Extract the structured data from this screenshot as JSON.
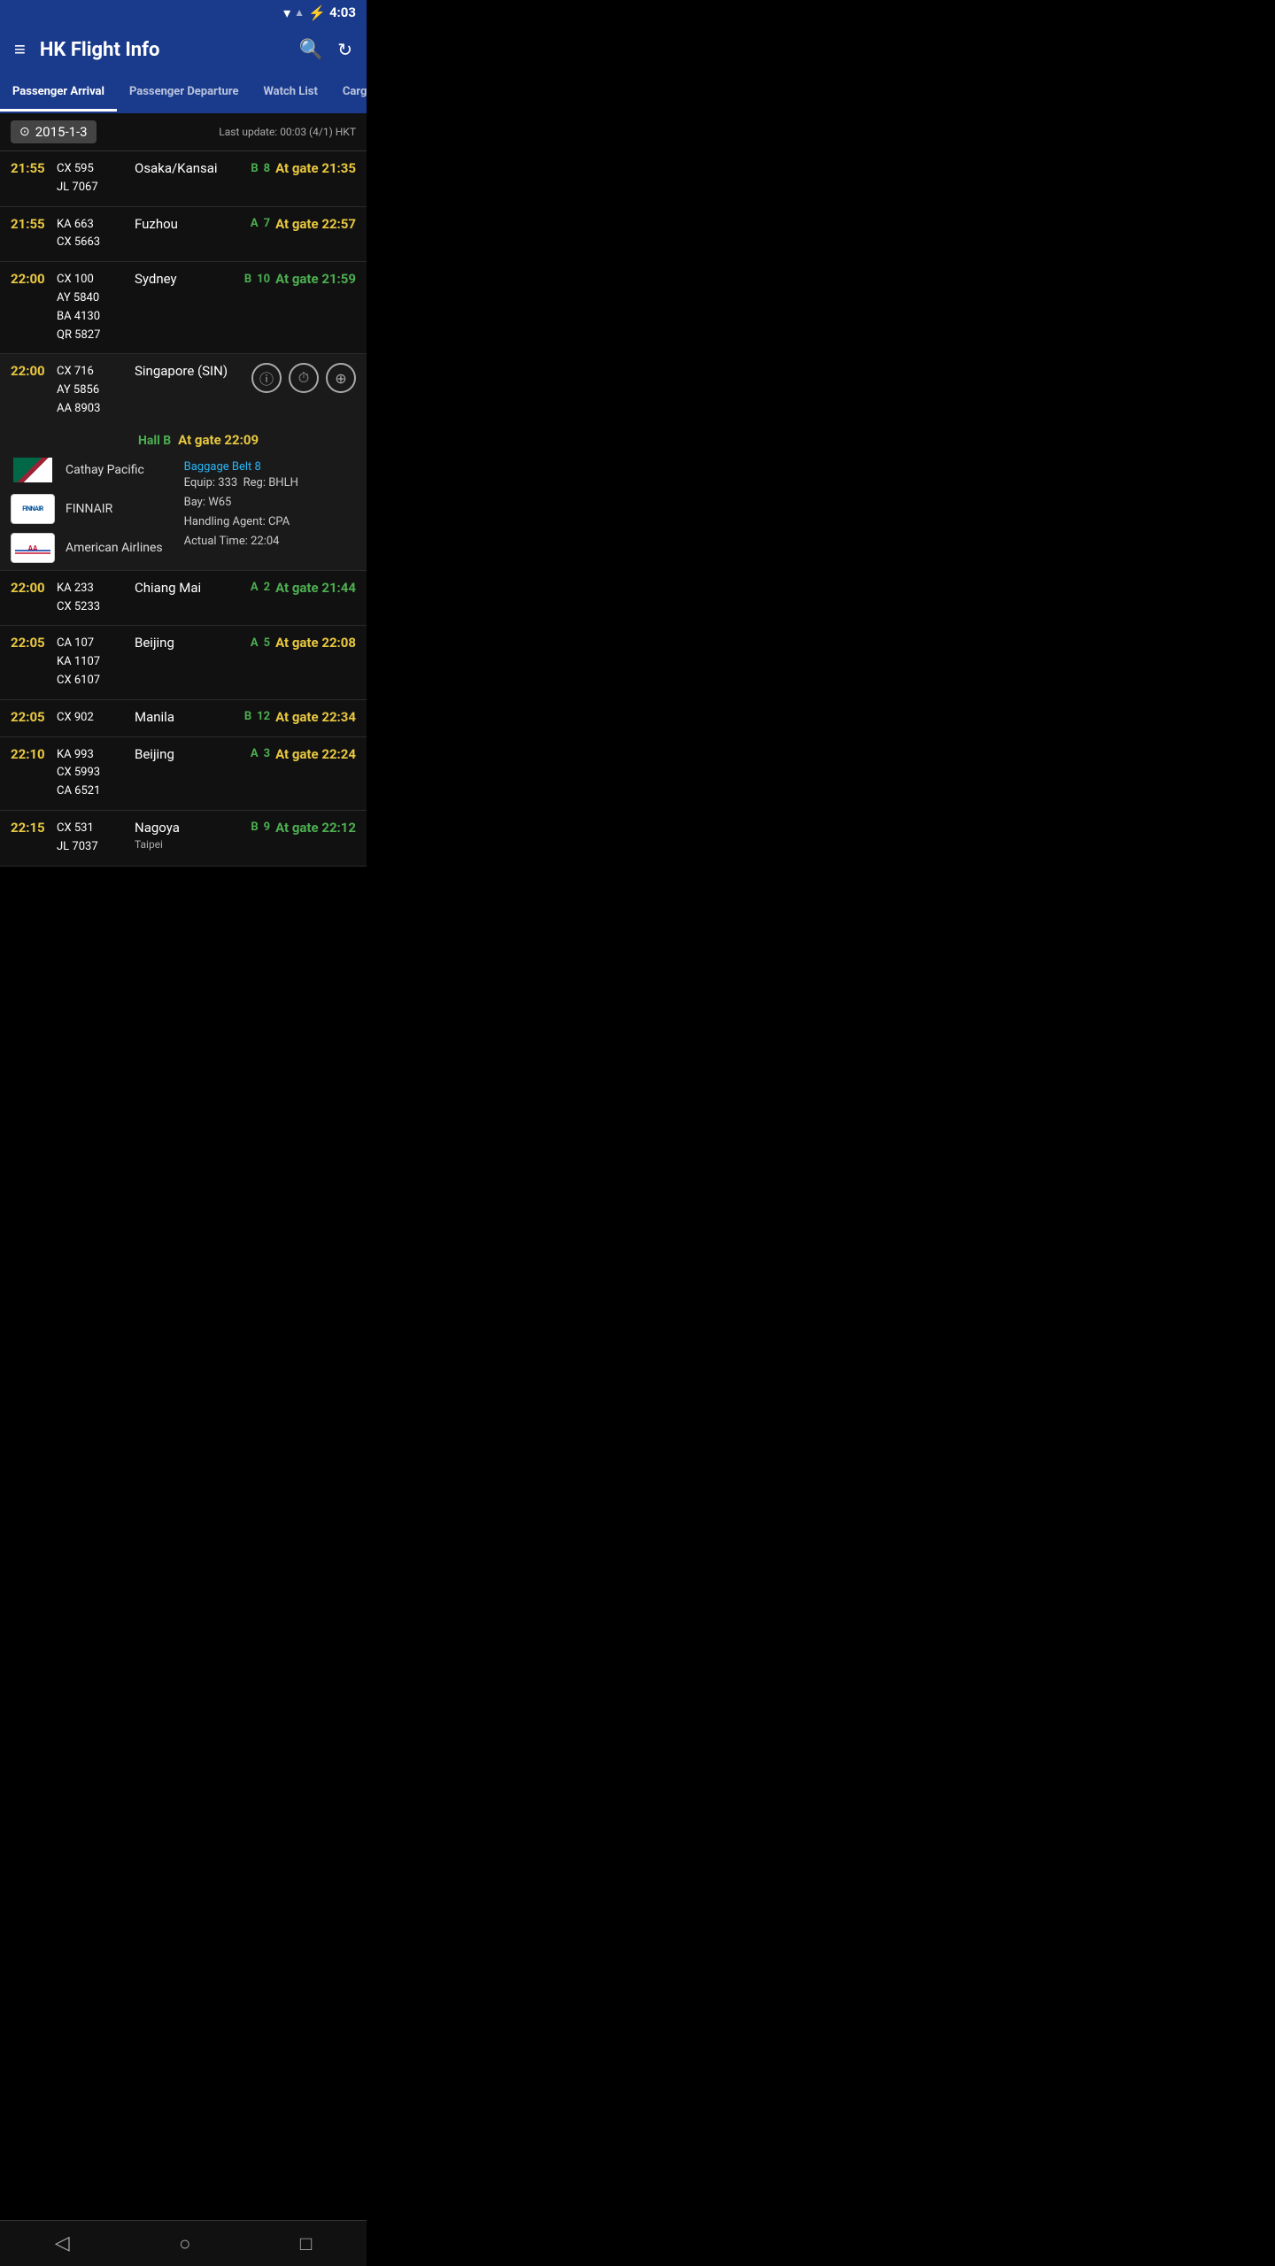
{
  "statusBar": {
    "time": "4:03",
    "icons": [
      "wifi",
      "signal",
      "battery"
    ]
  },
  "appBar": {
    "title": "HK Flight Info",
    "menuIcon": "≡",
    "searchIcon": "🔍",
    "refreshIcon": "↻"
  },
  "tabs": [
    {
      "id": "passenger-arrival",
      "label": "Passenger Arrival",
      "active": true
    },
    {
      "id": "passenger-departure",
      "label": "Passenger Departure",
      "active": false
    },
    {
      "id": "watch-list",
      "label": "Watch List",
      "active": false
    },
    {
      "id": "cargo-arrival",
      "label": "Cargo Arrival",
      "active": false
    }
  ],
  "dateBar": {
    "date": "2015-1-3",
    "lastUpdate": "Last update: 00:03 (4/1) HKT"
  },
  "flights": [
    {
      "time": "21:55",
      "flightNumbers": [
        "CX 595",
        "JL 7067"
      ],
      "destination": "Osaka/Kansai",
      "hall": "B",
      "gate": "8",
      "status": "At gate 21:35",
      "statusColor": "yellow",
      "expanded": false
    },
    {
      "time": "21:55",
      "flightNumbers": [
        "KA 663",
        "CX 5663"
      ],
      "destination": "Fuzhou",
      "hall": "A",
      "gate": "7",
      "status": "At gate 22:57",
      "statusColor": "yellow",
      "expanded": false
    },
    {
      "time": "22:00",
      "flightNumbers": [
        "CX 100",
        "AY 5840",
        "BA 4130",
        "QR 5827"
      ],
      "destination": "Sydney",
      "hall": "B",
      "gate": "10",
      "status": "At gate 21:59",
      "statusColor": "green",
      "expanded": false
    },
    {
      "time": "22:00",
      "flightNumbers": [
        "CX 716",
        "AY 5856",
        "AA 8903"
      ],
      "destination": "Singapore (SIN)",
      "hall": "Hall B",
      "gate": "",
      "status": "At gate 22:09",
      "statusColor": "yellow",
      "expanded": true,
      "baggageBelt": "Baggage Belt 8",
      "equip": "333",
      "reg": "BHLH",
      "bay": "W65",
      "handlingAgent": "CPA",
      "actualTime": "22:04",
      "airlines": [
        {
          "name": "Cathay Pacific",
          "logoType": "cx"
        },
        {
          "name": "FINNAIR",
          "logoType": "finnair"
        },
        {
          "name": "American Airlines",
          "logoType": "aa"
        }
      ]
    },
    {
      "time": "22:00",
      "flightNumbers": [
        "KA 233",
        "CX 5233"
      ],
      "destination": "Chiang Mai",
      "hall": "A",
      "gate": "2",
      "status": "At gate 21:44",
      "statusColor": "green",
      "expanded": false
    },
    {
      "time": "22:05",
      "flightNumbers": [
        "CA 107",
        "KA 1107",
        "CX 6107"
      ],
      "destination": "Beijing",
      "hall": "A",
      "gate": "5",
      "status": "At gate 22:08",
      "statusColor": "yellow",
      "expanded": false
    },
    {
      "time": "22:05",
      "flightNumbers": [
        "CX 902"
      ],
      "destination": "Manila",
      "hall": "B",
      "gate": "12",
      "status": "At gate 22:34",
      "statusColor": "yellow",
      "expanded": false
    },
    {
      "time": "22:10",
      "flightNumbers": [
        "KA 993",
        "CX 5993",
        "CA 6521"
      ],
      "destination": "Beijing",
      "hall": "A",
      "gate": "3",
      "status": "At gate 22:24",
      "statusColor": "yellow",
      "expanded": false
    },
    {
      "time": "22:15",
      "flightNumbers": [
        "CX 531",
        "JL 7037"
      ],
      "destination": "Nagoya / Taipei",
      "hall": "B",
      "gate": "9",
      "status": "At gate 22:12",
      "statusColor": "green",
      "expanded": false
    }
  ],
  "navBar": {
    "backIcon": "◁",
    "homeIcon": "○",
    "recentIcon": "□"
  }
}
